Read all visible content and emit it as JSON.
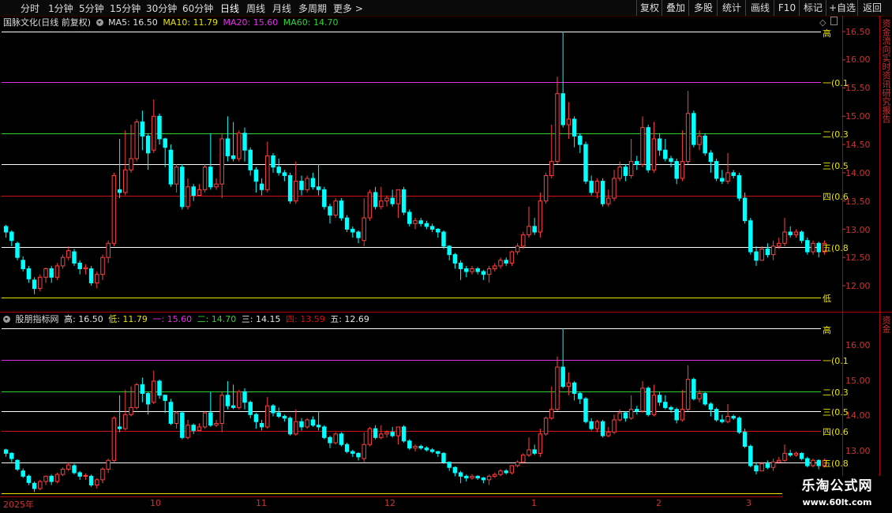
{
  "toolbar": {
    "periods": [
      "分时",
      "1分钟",
      "5分钟",
      "15分钟",
      "30分钟",
      "60分钟",
      "日线",
      "周线",
      "月线",
      "多周期",
      "更多 >"
    ],
    "active_period": "日线",
    "right_buttons": [
      "复权",
      "叠加",
      "多股",
      "统计",
      "画线",
      "F10",
      "标记",
      "+自选",
      "返回"
    ]
  },
  "main_panel": {
    "title": "国脉文化(日线 前复权)",
    "ma": [
      {
        "label": "MA5: 16.50",
        "color": "#e0e0e0"
      },
      {
        "label": "MA10: 11.79",
        "color": "#e8e000"
      },
      {
        "label": "MA20: 15.60",
        "color": "#e030e0"
      },
      {
        "label": "MA60: 14.70",
        "color": "#30d030"
      }
    ],
    "yaxis_ticks": [
      "16.50",
      "16.00",
      "15.50",
      "15.00",
      "14.50",
      "14.00",
      "13.50",
      "13.00",
      "12.50",
      "12.00"
    ],
    "levels": [
      {
        "name": "高",
        "price": 16.5,
        "color": "#ffffff",
        "label": "高"
      },
      {
        "name": "一",
        "price": 15.6,
        "color": "#e030e0",
        "label": "一(0.1"
      },
      {
        "name": "二",
        "price": 14.7,
        "color": "#30d030",
        "label": "二(0.3"
      },
      {
        "name": "三",
        "price": 14.15,
        "color": "#ffffff",
        "label": "三(0.5"
      },
      {
        "name": "四",
        "price": 13.59,
        "color": "#d01010",
        "label": "四(0.6"
      },
      {
        "name": "五",
        "price": 12.69,
        "color": "#ffffff",
        "label": "五(0.8"
      },
      {
        "name": "低",
        "price": 11.79,
        "color": "#e8e000",
        "label": "低"
      }
    ],
    "side_text": "资金流向实时资讯研究报告"
  },
  "sub_panel": {
    "title": "股朋指标网",
    "values": [
      {
        "label": "高: 16.50",
        "color": "#e0e0e0"
      },
      {
        "label": "低: 11.79",
        "color": "#e8e000"
      },
      {
        "label": "一: 15.60",
        "color": "#e030e0"
      },
      {
        "label": "二: 14.70",
        "color": "#30d030"
      },
      {
        "label": "三: 14.15",
        "color": "#e0e0e0"
      },
      {
        "label": "四: 13.59",
        "color": "#d01010"
      },
      {
        "label": "五: 12.69",
        "color": "#e0e0e0"
      }
    ],
    "yaxis_ticks": [
      "16.00",
      "15.00",
      "14.00",
      "13.00"
    ],
    "side_text": "资金"
  },
  "x_axis": {
    "labels": [
      "2025年",
      "10",
      "11",
      "12",
      "1",
      "2",
      "3"
    ]
  },
  "watermark": {
    "line1": "乐淘公式网",
    "line2": "www.60lt.com"
  },
  "colors": {
    "up": "#ff4040",
    "down": "#00ffff",
    "frame": "#b00000"
  },
  "chart_data": {
    "type": "candlestick",
    "title": "国脉文化(日线 前复权)",
    "ohlc": [
      [
        13.05,
        12.95,
        13.08,
        12.85
      ],
      [
        12.95,
        12.8,
        12.98,
        12.7
      ],
      [
        12.75,
        12.5,
        12.78,
        12.45
      ],
      [
        12.45,
        12.3,
        12.52,
        12.25
      ],
      [
        12.3,
        12.12,
        12.35,
        12.05
      ],
      [
        12.1,
        11.95,
        12.15,
        11.85
      ],
      [
        11.95,
        12.15,
        12.2,
        11.9
      ],
      [
        12.15,
        12.3,
        12.32,
        12.05
      ],
      [
        12.3,
        12.15,
        12.35,
        12.05
      ],
      [
        12.15,
        12.35,
        12.4,
        12.1
      ],
      [
        12.35,
        12.5,
        12.55,
        12.3
      ],
      [
        12.5,
        12.62,
        12.7,
        12.45
      ],
      [
        12.6,
        12.4,
        12.65,
        12.35
      ],
      [
        12.4,
        12.3,
        12.45,
        12.2
      ],
      [
        12.3,
        12.32,
        12.38,
        12.2
      ],
      [
        12.3,
        12.05,
        12.35,
        12.0
      ],
      [
        12.05,
        12.2,
        12.25,
        11.95
      ],
      [
        12.2,
        12.5,
        12.55,
        12.1
      ],
      [
        12.5,
        12.75,
        12.8,
        12.4
      ],
      [
        12.75,
        13.95,
        14.0,
        12.7
      ],
      [
        13.7,
        13.65,
        14.6,
        13.55
      ],
      [
        13.65,
        14.05,
        14.75,
        13.6
      ],
      [
        14.05,
        14.25,
        14.85,
        14.0
      ],
      [
        14.25,
        14.9,
        14.95,
        14.2
      ],
      [
        14.9,
        14.65,
        15.1,
        14.4
      ],
      [
        14.65,
        14.35,
        14.7,
        14.05
      ],
      [
        14.4,
        15.0,
        15.3,
        14.35
      ],
      [
        15.0,
        14.6,
        15.05,
        14.5
      ],
      [
        14.6,
        14.45,
        14.62,
        14.1
      ],
      [
        14.4,
        13.8,
        14.5,
        13.75
      ],
      [
        13.8,
        14.1,
        14.15,
        13.65
      ],
      [
        14.1,
        13.4,
        14.15,
        13.35
      ],
      [
        13.4,
        13.75,
        13.9,
        13.35
      ],
      [
        13.75,
        13.6,
        13.8,
        13.5
      ],
      [
        13.6,
        13.7,
        13.8,
        13.6
      ],
      [
        13.7,
        14.1,
        14.15,
        13.65
      ],
      [
        14.1,
        13.75,
        14.7,
        13.7
      ],
      [
        13.75,
        13.8,
        13.9,
        13.7
      ],
      [
        13.8,
        14.6,
        14.7,
        13.55
      ],
      [
        14.6,
        14.3,
        15.0,
        14.2
      ],
      [
        14.3,
        14.25,
        14.9,
        14.2
      ],
      [
        14.25,
        14.7,
        14.75,
        14.2
      ],
      [
        14.7,
        14.4,
        14.8,
        14.2
      ],
      [
        14.4,
        14.05,
        14.45,
        13.95
      ],
      [
        14.05,
        13.85,
        14.1,
        13.65
      ],
      [
        13.8,
        13.7,
        13.9,
        13.6
      ],
      [
        13.7,
        14.3,
        14.55,
        13.65
      ],
      [
        14.3,
        14.1,
        14.35,
        14.0
      ],
      [
        14.1,
        14.0,
        14.25,
        13.95
      ],
      [
        14.0,
        13.95,
        14.05,
        13.85
      ],
      [
        13.95,
        13.5,
        14.0,
        13.45
      ],
      [
        13.5,
        13.85,
        14.2,
        13.45
      ],
      [
        13.85,
        13.7,
        13.95,
        13.6
      ],
      [
        13.7,
        13.9,
        13.95,
        13.65
      ],
      [
        13.9,
        13.75,
        14.0,
        13.7
      ],
      [
        13.75,
        13.7,
        14.15,
        13.6
      ],
      [
        13.7,
        13.4,
        13.75,
        13.35
      ],
      [
        13.4,
        13.25,
        13.45,
        13.1
      ],
      [
        13.25,
        13.5,
        13.55,
        13.2
      ],
      [
        13.5,
        13.2,
        13.55,
        13.15
      ],
      [
        13.2,
        13.0,
        13.25,
        12.95
      ],
      [
        13.0,
        12.95,
        13.05,
        12.85
      ],
      [
        12.95,
        12.85,
        12.98,
        12.75
      ],
      [
        12.8,
        13.2,
        13.55,
        12.7
      ],
      [
        13.2,
        13.65,
        13.7,
        13.15
      ],
      [
        13.65,
        13.4,
        13.75,
        13.35
      ],
      [
        13.4,
        13.5,
        13.75,
        13.35
      ],
      [
        13.5,
        13.55,
        13.6,
        13.4
      ],
      [
        13.55,
        13.45,
        13.7,
        13.4
      ],
      [
        13.45,
        13.7,
        13.7,
        13.2
      ],
      [
        13.7,
        13.3,
        13.75,
        13.25
      ],
      [
        13.3,
        13.1,
        13.35,
        13.05
      ],
      [
        13.1,
        13.15,
        13.2,
        13.0
      ],
      [
        13.15,
        13.1,
        13.2,
        13.05
      ],
      [
        13.1,
        13.05,
        13.15,
        13.0
      ],
      [
        13.05,
        13.0,
        13.1,
        12.95
      ],
      [
        13.0,
        12.95,
        13.02,
        12.85
      ],
      [
        12.95,
        12.7,
        12.98,
        12.65
      ],
      [
        12.7,
        12.55,
        12.72,
        12.45
      ],
      [
        12.55,
        12.4,
        12.58,
        12.3
      ],
      [
        12.4,
        12.3,
        12.45,
        12.1
      ],
      [
        12.3,
        12.25,
        12.35,
        12.15
      ],
      [
        12.25,
        12.3,
        12.35,
        12.2
      ],
      [
        12.3,
        12.25,
        12.33,
        12.2
      ],
      [
        12.25,
        12.2,
        12.28,
        12.1
      ],
      [
        12.2,
        12.3,
        12.35,
        12.05
      ],
      [
        12.3,
        12.35,
        12.4,
        12.25
      ],
      [
        12.35,
        12.45,
        12.5,
        12.3
      ],
      [
        12.45,
        12.4,
        12.5,
        12.35
      ],
      [
        12.4,
        12.6,
        12.62,
        12.35
      ],
      [
        12.6,
        12.7,
        12.75,
        12.55
      ],
      [
        12.7,
        12.9,
        12.95,
        12.65
      ],
      [
        12.9,
        13.05,
        13.4,
        12.85
      ],
      [
        13.05,
        12.95,
        13.2,
        12.9
      ],
      [
        12.95,
        13.5,
        13.65,
        12.85
      ],
      [
        13.5,
        13.95,
        14.0,
        13.45
      ],
      [
        13.95,
        14.2,
        14.85,
        13.9
      ],
      [
        14.2,
        15.4,
        15.7,
        14.15
      ],
      [
        15.4,
        14.85,
        16.5,
        14.8
      ],
      [
        14.85,
        14.95,
        15.25,
        14.6
      ],
      [
        14.95,
        14.65,
        15.0,
        14.45
      ],
      [
        14.65,
        14.5,
        14.7,
        14.35
      ],
      [
        14.5,
        13.85,
        14.55,
        13.8
      ],
      [
        13.85,
        13.65,
        13.95,
        13.6
      ],
      [
        13.65,
        13.85,
        13.9,
        13.55
      ],
      [
        13.85,
        13.45,
        13.9,
        13.4
      ],
      [
        13.45,
        13.55,
        13.7,
        13.4
      ],
      [
        13.55,
        13.9,
        14.05,
        13.5
      ],
      [
        13.9,
        14.1,
        14.2,
        13.85
      ],
      [
        14.1,
        13.95,
        14.15,
        13.85
      ],
      [
        13.95,
        14.2,
        14.6,
        13.9
      ],
      [
        14.2,
        14.15,
        14.3,
        14.05
      ],
      [
        14.15,
        14.8,
        15.0,
        14.1
      ],
      [
        14.8,
        14.05,
        14.85,
        14.0
      ],
      [
        14.05,
        14.6,
        14.9,
        14.0
      ],
      [
        14.6,
        14.4,
        14.7,
        14.3
      ],
      [
        14.4,
        14.25,
        14.6,
        14.2
      ],
      [
        14.25,
        14.2,
        14.3,
        14.1
      ],
      [
        14.2,
        13.9,
        14.25,
        13.8
      ],
      [
        13.9,
        14.2,
        14.75,
        13.85
      ],
      [
        14.2,
        15.05,
        15.45,
        14.15
      ],
      [
        15.05,
        14.5,
        15.1,
        14.45
      ],
      [
        14.5,
        14.65,
        14.75,
        14.4
      ],
      [
        14.65,
        14.35,
        14.7,
        14.3
      ],
      [
        14.35,
        14.2,
        14.4,
        14.0
      ],
      [
        14.2,
        13.9,
        14.25,
        13.85
      ],
      [
        13.9,
        13.85,
        14.05,
        13.8
      ],
      [
        13.85,
        14.0,
        14.35,
        13.8
      ],
      [
        14.0,
        13.95,
        14.05,
        13.9
      ],
      [
        13.95,
        13.55,
        14.0,
        13.5
      ],
      [
        13.55,
        13.15,
        13.65,
        13.1
      ],
      [
        13.15,
        12.6,
        13.2,
        12.55
      ],
      [
        12.6,
        12.45,
        12.7,
        12.35
      ],
      [
        12.45,
        12.65,
        12.7,
        12.45
      ],
      [
        12.65,
        12.55,
        12.75,
        12.5
      ],
      [
        12.55,
        12.7,
        12.8,
        12.45
      ],
      [
        12.7,
        12.75,
        12.85,
        12.65
      ],
      [
        12.75,
        12.95,
        13.2,
        12.7
      ],
      [
        12.95,
        12.9,
        13.05,
        12.85
      ],
      [
        12.9,
        12.95,
        13.0,
        12.85
      ],
      [
        12.95,
        12.8,
        12.98,
        12.75
      ],
      [
        12.8,
        12.6,
        12.85,
        12.55
      ],
      [
        12.6,
        12.75,
        12.8,
        12.55
      ],
      [
        12.75,
        12.6,
        12.78,
        12.5
      ],
      [
        12.6,
        12.75,
        12.8,
        12.55
      ]
    ],
    "ylim_main": [
      11.8,
      16.5
    ],
    "ylim_sub": [
      12.4,
      16.5
    ]
  }
}
